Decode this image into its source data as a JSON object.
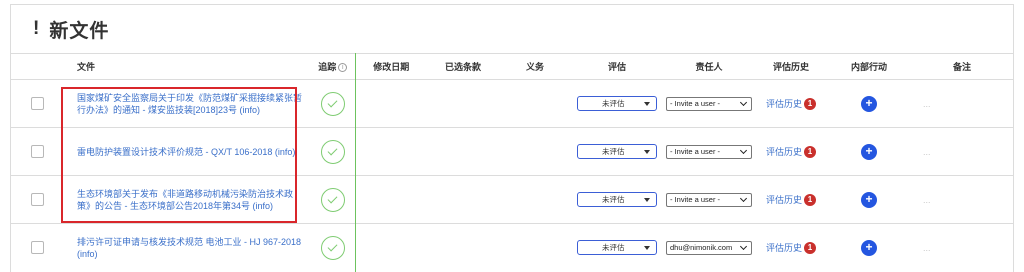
{
  "section": {
    "bang": "!",
    "title": "新文件"
  },
  "columns": {
    "document": "文件",
    "tracking": "追踪",
    "modified": "修改日期",
    "selected": "已选条款",
    "duty": "义务",
    "evaluation": "评估",
    "owner": "责任人",
    "history": "评估历史",
    "action": "内部行动",
    "note": "备注"
  },
  "info_glyph": "i",
  "rows": [
    {
      "title": "国家煤矿安全监察局关于印发《防范煤矿采掘接续紧张暂行办法》的通知 - 煤安监技装[2018]23号 (info)",
      "evaluation": "未评估",
      "owner": "- Invite a user -",
      "history": "评估历史",
      "badge": "1",
      "action": "+",
      "note": "..."
    },
    {
      "title": "雷电防护装置设计技术评价规范 - QX/T 106-2018 (info)",
      "evaluation": "未评估",
      "owner": "- Invite a user -",
      "history": "评估历史",
      "badge": "1",
      "action": "+",
      "note": "..."
    },
    {
      "title": "生态环境部关于发布《非道路移动机械污染防治技术政策》的公告 - 生态环境部公告2018年第34号 (info)",
      "evaluation": "未评估",
      "owner": "- Invite a user -",
      "history": "评估历史",
      "badge": "1",
      "action": "+",
      "note": "..."
    },
    {
      "title": "排污许可证申请与核发技术规范 电池工业 - HJ 967-2018 (info)",
      "evaluation": "未评估",
      "owner": "dhu@nimonik.com",
      "history": "评估历史",
      "badge": "1",
      "action": "+",
      "note": "..."
    }
  ],
  "colors": {
    "link": "#3a6fc9",
    "eval_border": "#3b5ed6",
    "check_green": "#7fcc72",
    "badge_red": "#c9302c",
    "action_blue": "#2456e0",
    "highlight_red": "#d9262b"
  },
  "icons": {
    "tracking": "check-circle-icon",
    "info": "info-icon",
    "action": "plus-icon"
  }
}
